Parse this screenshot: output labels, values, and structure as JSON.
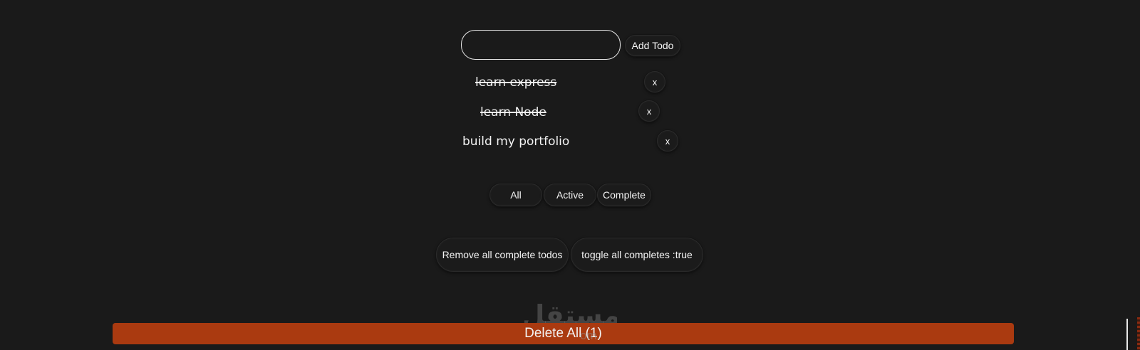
{
  "add_todo": {
    "input_value": "",
    "input_placeholder": "",
    "button_label": "Add Todo"
  },
  "todos": [
    {
      "text": "learn express",
      "completed": true,
      "remove_label": "x"
    },
    {
      "text": "learn Node",
      "completed": true,
      "remove_label": "x"
    },
    {
      "text": "build my portfolio",
      "completed": false,
      "remove_label": "x"
    }
  ],
  "filters": {
    "all": "All",
    "active": "Active",
    "complete": "Complete"
  },
  "bulk_actions": {
    "remove_complete": "Remove all complete todos",
    "toggle_all": "toggle all completes :true"
  },
  "delete_all": {
    "label": "Delete All (1)"
  },
  "watermark": {
    "logo_text": "مستقل",
    "url_text": "om"
  },
  "colors": {
    "background": "#1a1a1a",
    "delete_bar": "#aa3a10",
    "text": "#f2f2f2"
  }
}
